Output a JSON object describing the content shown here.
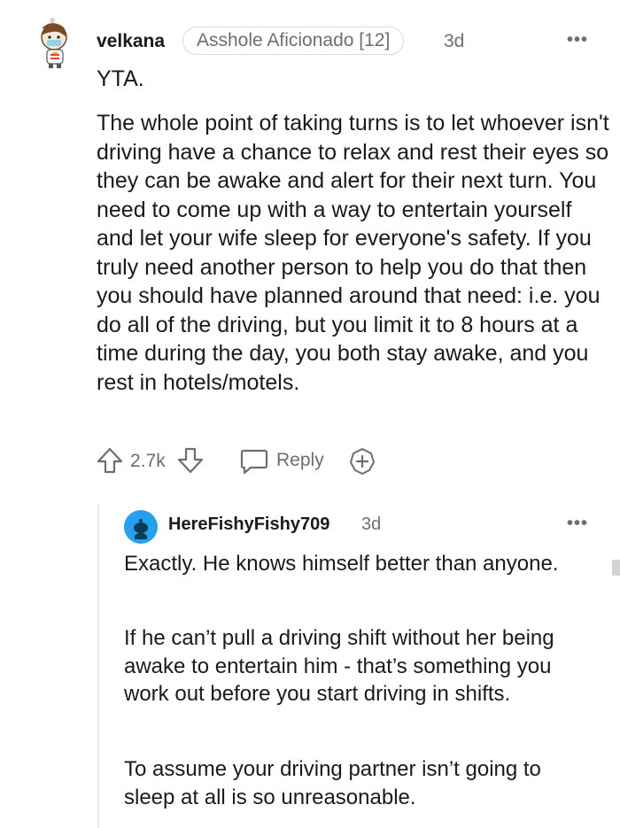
{
  "comment": {
    "author": "velkana",
    "flair": "Asshole Aficionado [12]",
    "age": "3d",
    "more_label": "•••",
    "paragraphs": [
      "YTA.",
      "The whole point of taking turns is to let whoever isn't driving have a chance to relax and rest their eyes so they can be awake and alert for their next turn. You need to come up with a way to entertain yourself and let your wife sleep for everyone's safety. If you truly need another person to help you do that then you should have planned around that need: i.e. you do all of the driving, but you limit it to 8 hours at a time during the day, you both stay awake, and you rest in hotels/motels."
    ],
    "score": "2.7k",
    "reply_label": "Reply",
    "icons": [
      "upvote-icon",
      "downvote-icon",
      "reply-bubble-icon",
      "award-icon",
      "more-icon"
    ]
  },
  "reply": {
    "author": "HereFishyFishy709",
    "age": "3d",
    "more_label": "•••",
    "paragraphs": [
      "Exactly. He knows himself better than anyone.",
      "If he can’t pull a driving shift without her being awake to entertain him - that’s something you work out before you start driving in shifts.",
      "To assume your driving partner isn’t going to sleep at all is so unreasonable."
    ]
  },
  "colors": {
    "text": "#1a1a1b",
    "meta": "#6b6f72",
    "reply_avatar": "#24a0ed",
    "thread_line": "#e6e8ea"
  }
}
